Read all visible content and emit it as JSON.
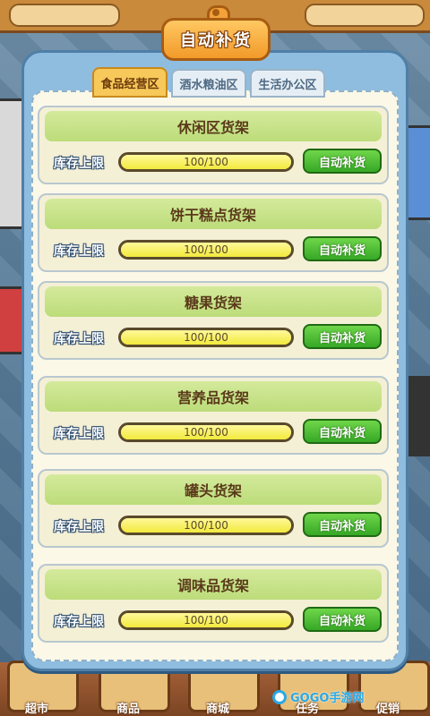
{
  "dialog": {
    "title": "自动补货",
    "tabs": [
      {
        "label": "食品经营区",
        "active": true
      },
      {
        "label": "酒水粮油区",
        "active": false
      },
      {
        "label": "生活办公区",
        "active": false
      }
    ]
  },
  "shelves": [
    {
      "name": "休闲区货架",
      "stock_label": "库存上限",
      "stock_text": "100/100",
      "stock_fraction": 1.0,
      "button": "自动补货"
    },
    {
      "name": "饼干糕点货架",
      "stock_label": "库存上限",
      "stock_text": "100/100",
      "stock_fraction": 1.0,
      "button": "自动补货"
    },
    {
      "name": "糖果货架",
      "stock_label": "库存上限",
      "stock_text": "100/100",
      "stock_fraction": 1.0,
      "button": "自动补货"
    },
    {
      "name": "营养品货架",
      "stock_label": "库存上限",
      "stock_text": "100/100",
      "stock_fraction": 1.0,
      "button": "自动补货"
    },
    {
      "name": "罐头货架",
      "stock_label": "库存上限",
      "stock_text": "100/100",
      "stock_fraction": 1.0,
      "button": "自动补货"
    },
    {
      "name": "调味品货架",
      "stock_label": "库存上限",
      "stock_text": "100/100",
      "stock_fraction": 1.0,
      "button": "自动补货"
    }
  ],
  "background": {
    "bottom_menu": [
      "超市",
      "商品",
      "商城",
      "任务",
      "促销"
    ]
  },
  "watermark": "GOGO手游网",
  "colors": {
    "accent": "#f29a2a",
    "button_green": "#36a826",
    "panel_blue": "#8fbde0"
  }
}
